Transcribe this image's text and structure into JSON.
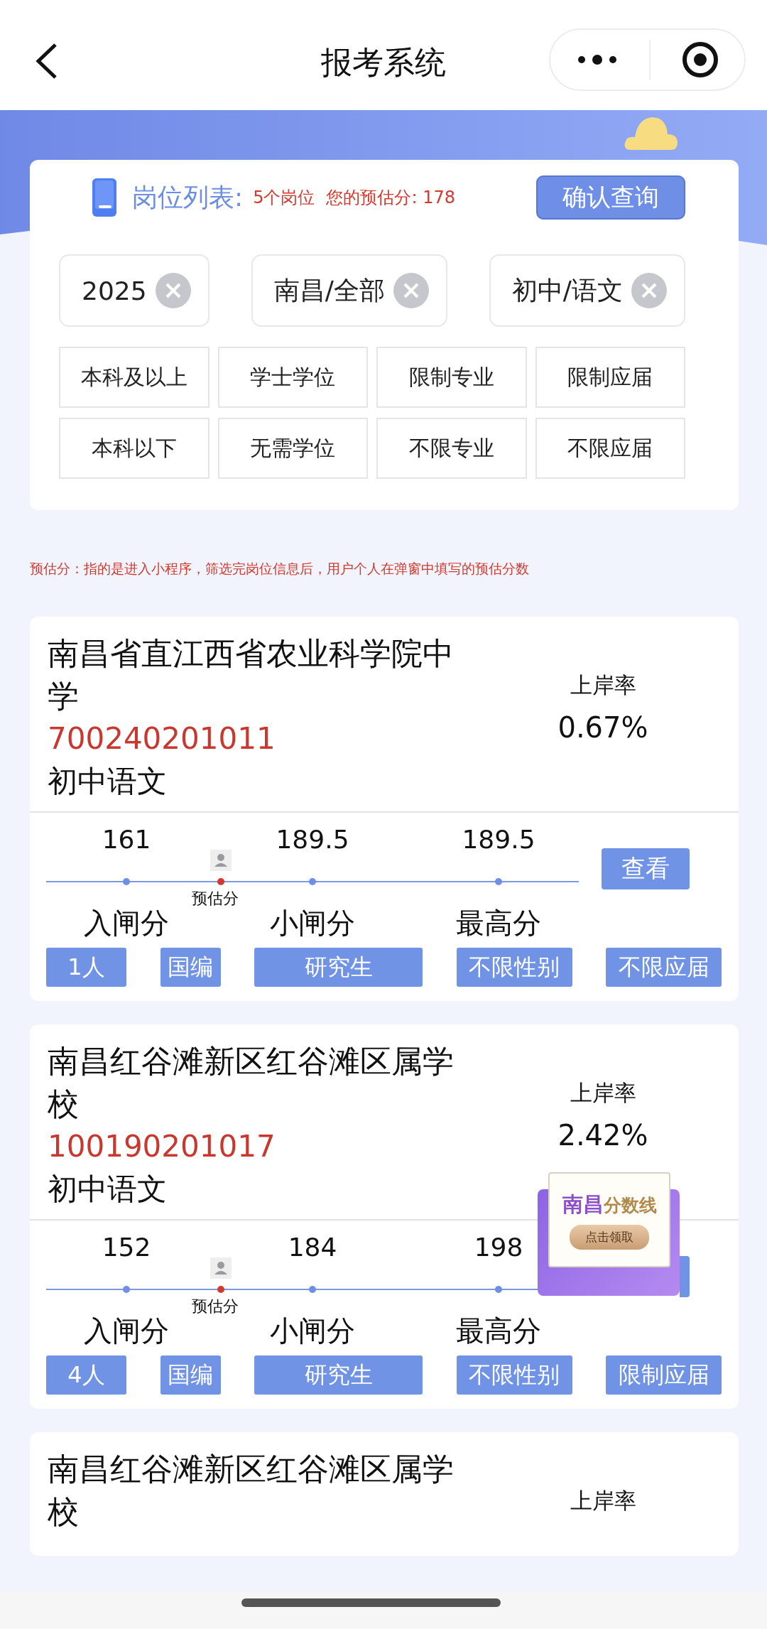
{
  "nav": {
    "title": "报考系统"
  },
  "filter": {
    "heading": "岗位列表:",
    "count": "5个岗位",
    "estimate": "您的预估分: 178",
    "confirm": "确认查询",
    "chips": [
      "2025",
      "南昌/全部",
      "初中/语文"
    ],
    "options": [
      [
        "本科及以上",
        "学士学位",
        "限制专业",
        "限制应届"
      ],
      [
        "本科以下",
        "无需学位",
        "不限专业",
        "不限应届"
      ]
    ]
  },
  "note": "预估分：指的是进入小程序，筛选完岗位信息后，用户个人在弹窗中填写的预估分数",
  "cards": [
    {
      "title": "南昌省直江西省农业科学院中学",
      "code": "700240201011",
      "subject": "初中语文",
      "rate_label": "上岸率",
      "rate": "0.67%",
      "scores": [
        {
          "value": "161",
          "label": "入闸分"
        },
        {
          "value": "189.5",
          "label": "小闸分"
        },
        {
          "value": "189.5",
          "label": "最高分"
        }
      ],
      "estimate_label": "预估分",
      "view": "查看",
      "tags": [
        "1人",
        "国编",
        "研究生",
        "不限性别",
        "不限应届"
      ]
    },
    {
      "title": "南昌红谷滩新区红谷滩区属学校",
      "code": "100190201017",
      "subject": "初中语文",
      "rate_label": "上岸率",
      "rate": "2.42%",
      "scores": [
        {
          "value": "152",
          "label": "入闸分"
        },
        {
          "value": "184",
          "label": "小闸分"
        },
        {
          "value": "198",
          "label": "最高分"
        }
      ],
      "estimate_label": "预估分",
      "view_covered": true,
      "ad": {
        "city": "南昌",
        "topic": "分数线",
        "action": "点击领取"
      },
      "tags": [
        "4人",
        "国编",
        "研究生",
        "不限性别",
        "限制应届"
      ]
    },
    {
      "title": "南昌红谷滩新区红谷滩区属学校",
      "rate_label": "上岸率"
    }
  ]
}
